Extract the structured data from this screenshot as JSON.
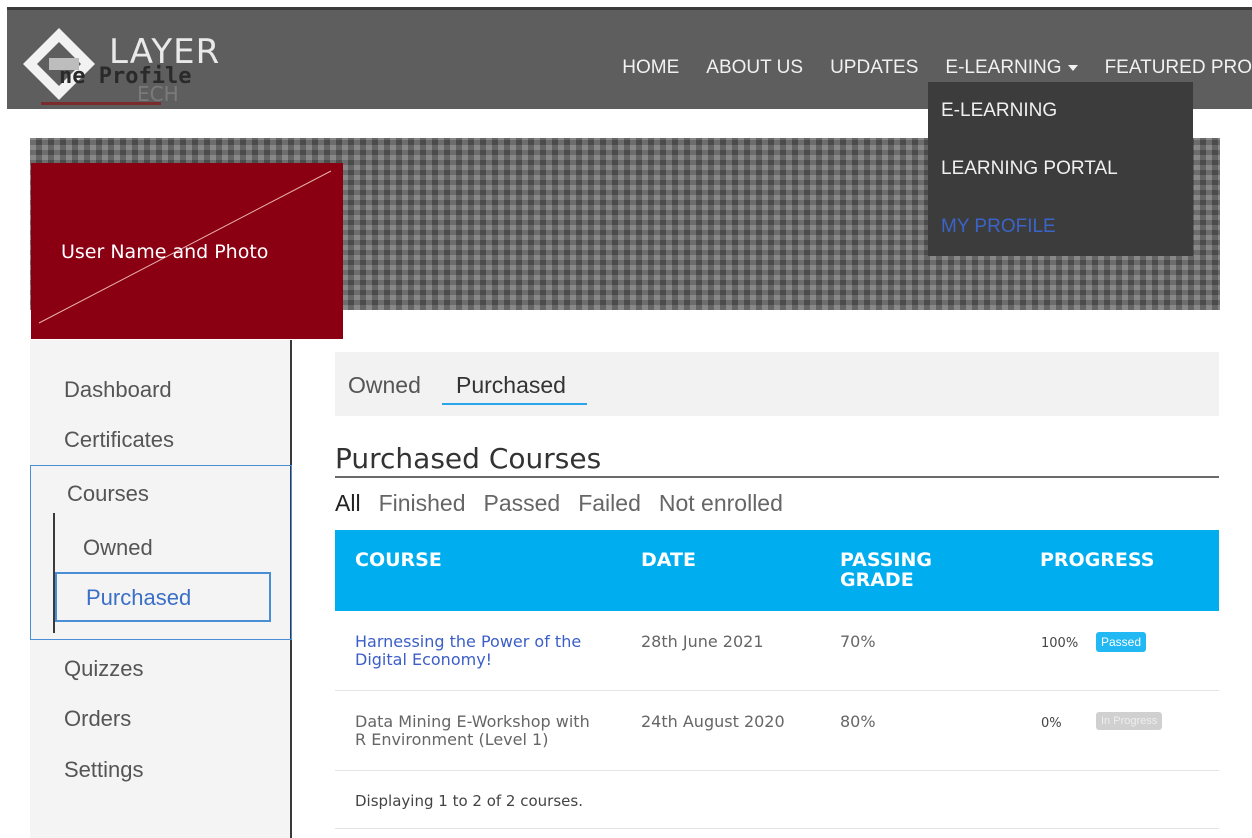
{
  "brand": {
    "logo_main": "LAYER",
    "logo_sub": "ne Profile",
    "logo_sub2": "ECH"
  },
  "nav": {
    "items": [
      "HOME",
      "ABOUT US",
      "UPDATES",
      "E-LEARNING",
      "FEATURED PRO"
    ]
  },
  "dropdown": {
    "items": [
      "E-LEARNING",
      "LEARNING PORTAL",
      "MY PROFILE"
    ],
    "active": "MY PROFILE"
  },
  "profile": {
    "user_label": "User Name and  Photo"
  },
  "sidebar": {
    "items": [
      "Dashboard",
      "Certificates",
      "Courses",
      "Owned",
      "Purchased",
      "Quizzes",
      "Orders",
      "Settings"
    ]
  },
  "tabs": [
    "Owned",
    "Purchased"
  ],
  "section": {
    "title": "Purchased Courses",
    "filters": [
      "All",
      "Finished",
      "Passed",
      "Failed",
      "Not enrolled"
    ]
  },
  "table": {
    "headers": {
      "course": "COURSE",
      "date": "DATE",
      "passing_line1": "PASSING",
      "passing_line2": "GRADE",
      "progress": "PROGRESS"
    },
    "rows": [
      {
        "course_line1": "Harnessing the Power of the",
        "course_line2": "Digital Economy!",
        "date": "28th June 2021",
        "grade": "70%",
        "progress": "100%",
        "status": "Passed"
      },
      {
        "course_line1": "Data Mining E-Workshop with",
        "course_line2": "R Environment (Level 1)",
        "date": "24th August 2020",
        "grade": "80%",
        "progress": "0%",
        "status": "In Progress"
      }
    ],
    "footer": "Displaying 1 to 2 of 2 courses."
  },
  "colors": {
    "header_bg": "#5e5e5e",
    "accent_blue": "#00aef0",
    "profile_red": "#8a0012",
    "link_blue": "#3b5ec7",
    "passed_badge": "#21b8f3",
    "progress_badge": "#d0d0d0"
  }
}
